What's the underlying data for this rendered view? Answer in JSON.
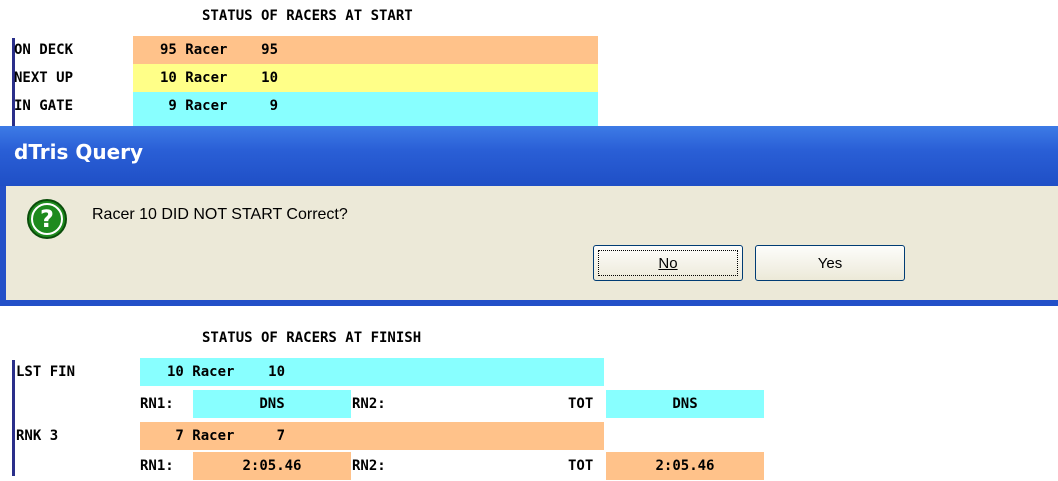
{
  "start": {
    "title": "STATUS OF RACERS AT START",
    "rows": [
      {
        "label": "ON DECK",
        "racer": "95 Racer    95"
      },
      {
        "label": "NEXT UP",
        "racer": "10 Racer    10"
      },
      {
        "label": "IN GATE",
        "racer": " 9 Racer     9"
      }
    ]
  },
  "dialog": {
    "title": "dTris Query",
    "message": "Racer 10 DID NOT START Correct?",
    "no_label": "No",
    "yes_label": "Yes",
    "icon": "question-icon"
  },
  "finish": {
    "title": "STATUS OF RACERS AT FINISH",
    "last_finish": {
      "label": "LST FIN",
      "racer": "10 Racer    10",
      "rn1_label": "RN1:",
      "rn1_value": "DNS",
      "rn2_label": "RN2:",
      "tot_label": "TOT",
      "tot_value": "DNS"
    },
    "rank": {
      "label": "RNK 3",
      "racer": " 7 Racer     7",
      "rn1_label": "RN1:",
      "rn1_value": "2:05.46",
      "rn2_label": "RN2:",
      "tot_label": "TOT",
      "tot_value": "2:05.46"
    }
  },
  "colors": {
    "orange": "#ffc28a",
    "yellow": "#ffff88",
    "cyan": "#88ffff",
    "title_bar": "#2a5fd6"
  }
}
